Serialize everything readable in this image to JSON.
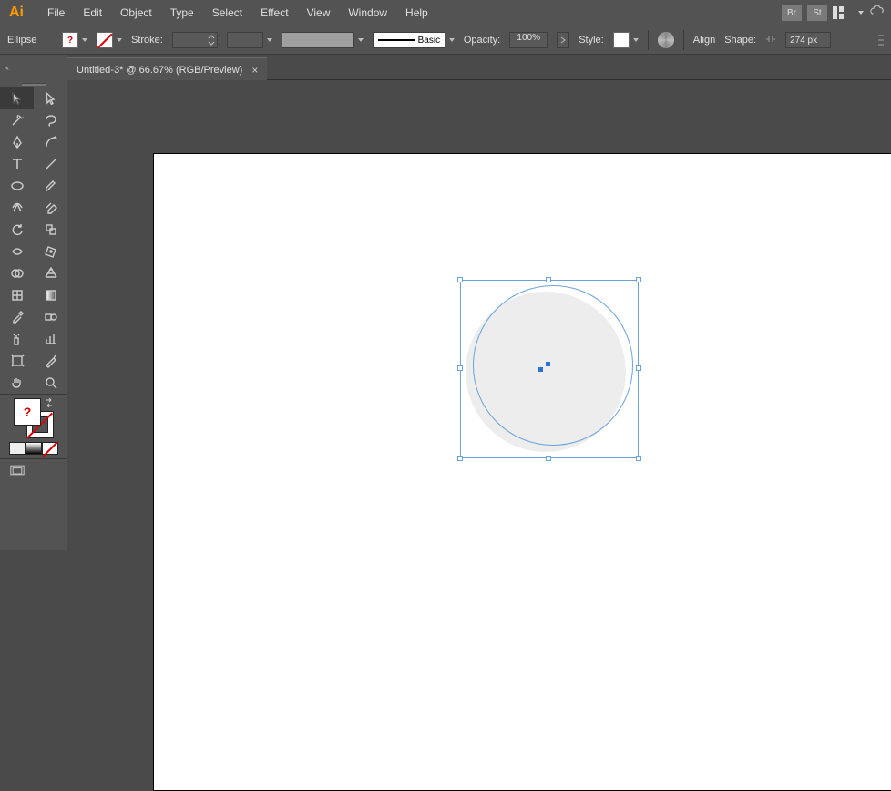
{
  "app": {
    "logo": "Ai"
  },
  "menu": {
    "items": [
      "File",
      "Edit",
      "Object",
      "Type",
      "Select",
      "Effect",
      "View",
      "Window",
      "Help"
    ],
    "right": {
      "br": "Br",
      "st": "St"
    }
  },
  "control": {
    "selection_name": "Ellipse",
    "fill_unknown_mark": "?",
    "stroke_label": "Stroke:",
    "brush_label": "Basic",
    "opacity_label": "Opacity:",
    "opacity_value": "100%",
    "style_label": "Style:",
    "align_label": "Align",
    "shape_label": "Shape:",
    "width_value": "274 px"
  },
  "doc_tab": {
    "title": "Untitled-3* @ 66.67% (RGB/Preview)",
    "close": "×"
  },
  "panel_strip": {
    "collapse": "‹‹"
  },
  "fill_swatch_unknown": "?"
}
